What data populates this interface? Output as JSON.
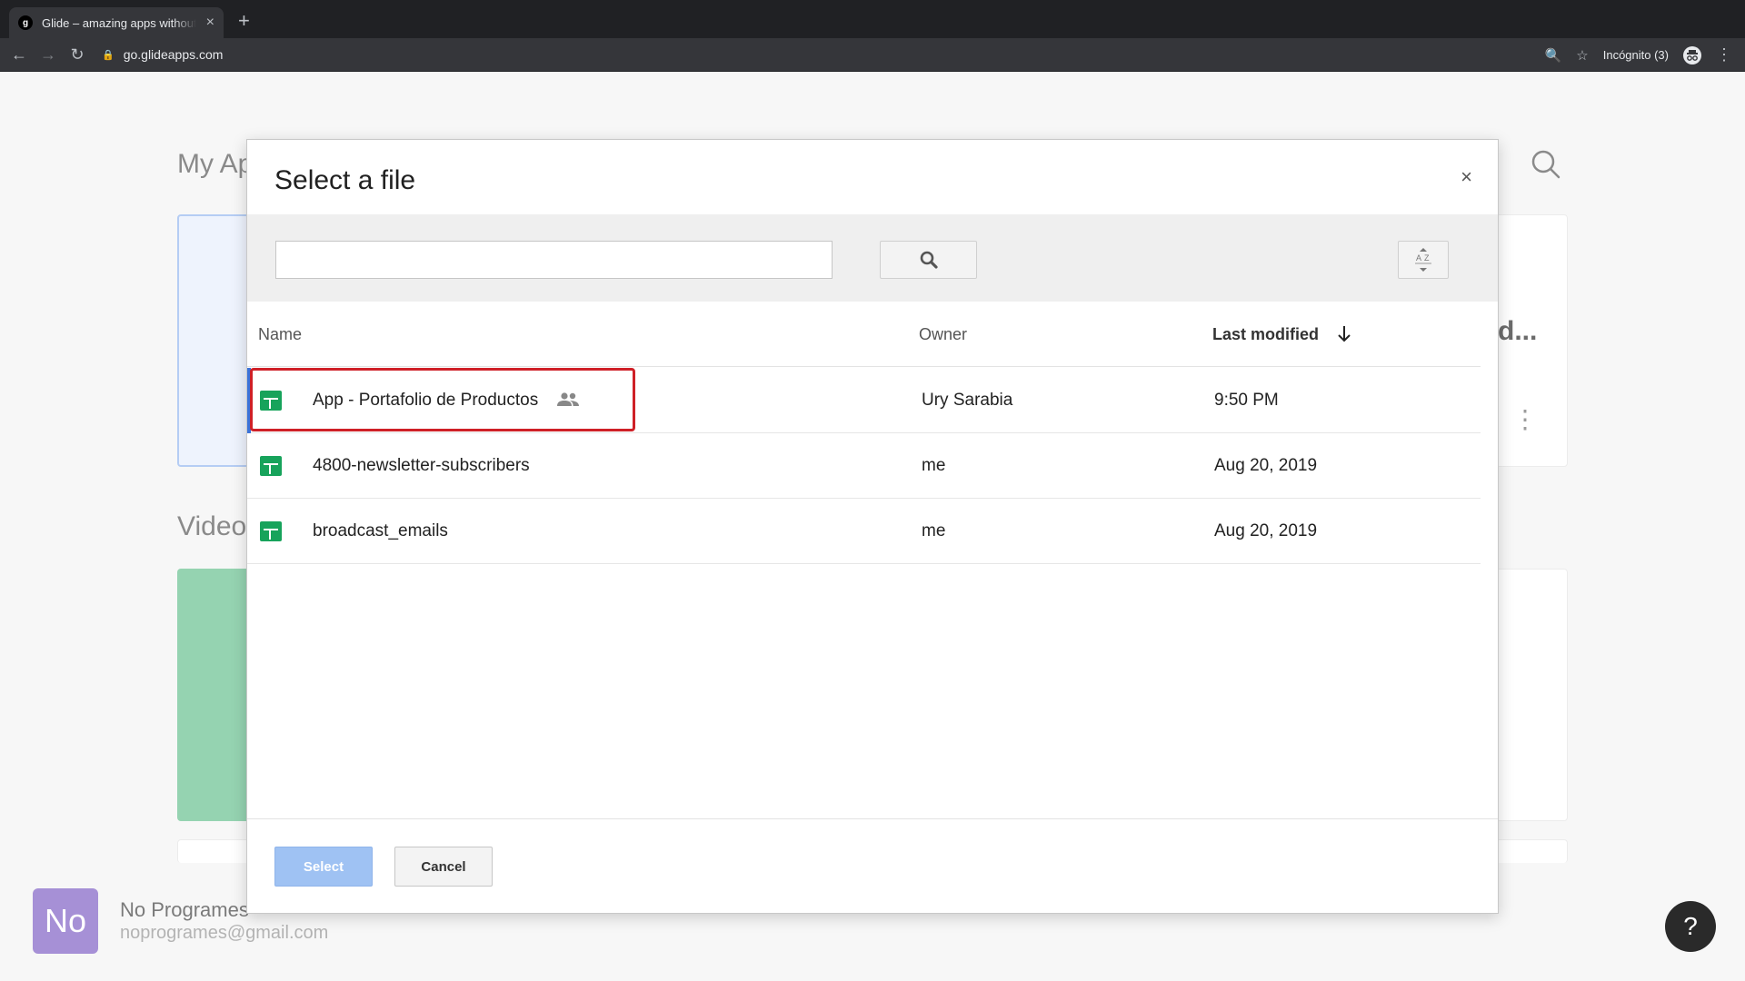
{
  "browser": {
    "tab_title": "Glide – amazing apps without code",
    "tab_favicon": "g",
    "tab_close": "×",
    "new_tab": "+",
    "url": "go.glideapps.com",
    "incognito_label": "Incógnito (3)",
    "back": "←",
    "forward": "→",
    "reload": "↻",
    "lock": "🔒",
    "zoom": "🔍",
    "star": "☆",
    "menu": "⋮"
  },
  "page": {
    "my_apps_title": "My Ap",
    "videos_title": "Video",
    "truncated_card_text": "d...",
    "kebab": "⋮",
    "user": {
      "avatar_text": "No",
      "name": "No Programes",
      "email": "noprogrames@gmail.com"
    },
    "help_label": "?"
  },
  "modal": {
    "title": "Select a file",
    "close_label": "×",
    "search": {
      "value": "",
      "placeholder": ""
    },
    "columns": {
      "name": "Name",
      "owner": "Owner",
      "last_modified": "Last modified"
    },
    "files": [
      {
        "name": "App - Portafolio de Productos",
        "owner": "Ury Sarabia",
        "modified": "9:50 PM",
        "shared": true,
        "selected": true
      },
      {
        "name": "4800-newsletter-subscribers",
        "owner": "me",
        "modified": "Aug 20, 2019",
        "shared": false,
        "selected": false
      },
      {
        "name": "broadcast_emails",
        "owner": "me",
        "modified": "Aug 20, 2019",
        "shared": false,
        "selected": false
      }
    ],
    "select_label": "Select",
    "cancel_label": "Cancel"
  },
  "colors": {
    "sheet_green": "#17a35b",
    "highlight_red": "#cf2027",
    "select_button": "#9fc2f3",
    "avatar_purple": "#a690d6"
  }
}
